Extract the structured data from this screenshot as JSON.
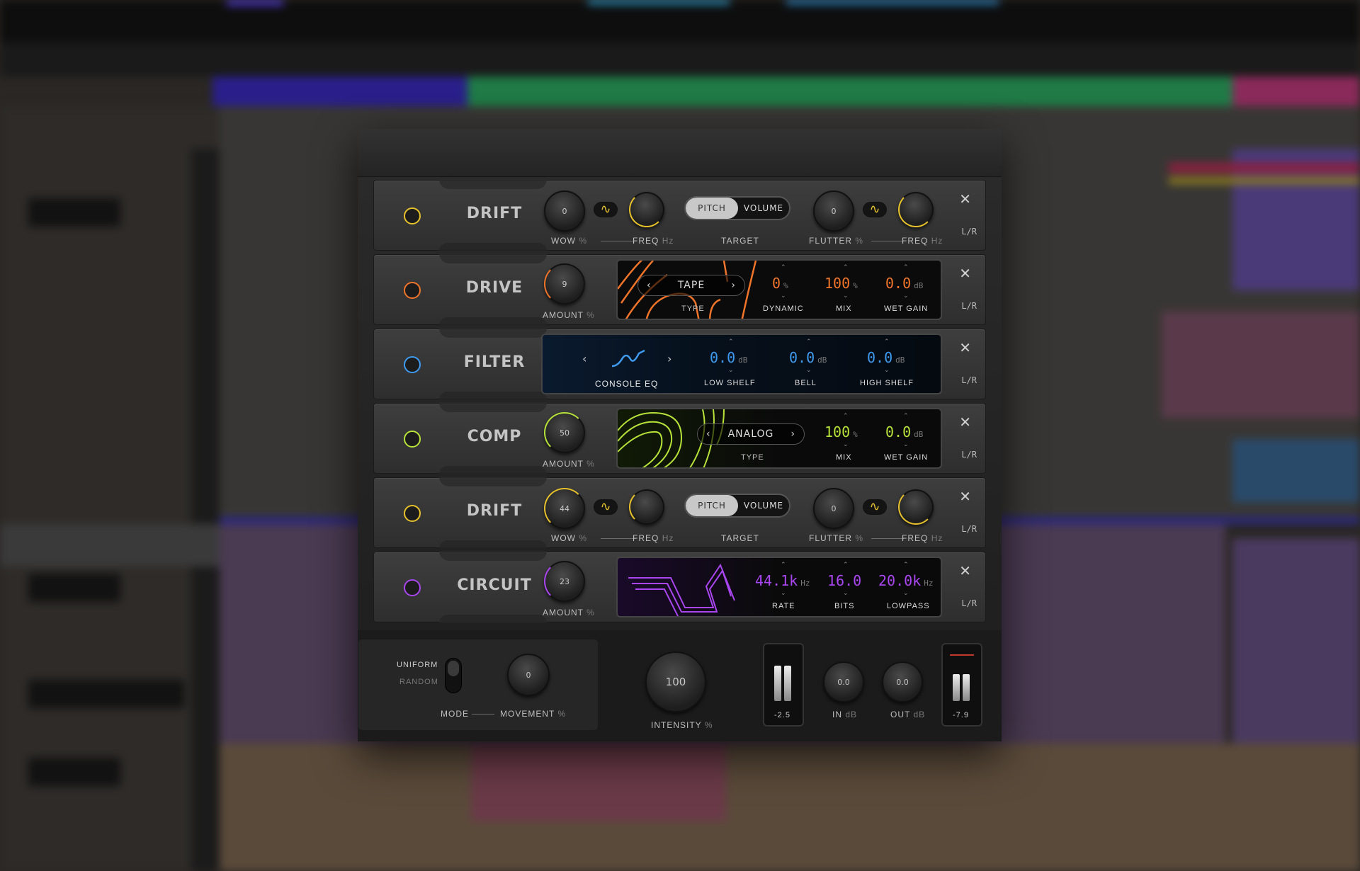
{
  "colors": {
    "drift": "#e6c12c",
    "drive": "#f0742a",
    "filter": "#3f9bf0",
    "comp": "#b7e23a",
    "circuit": "#a946f0",
    "segment_active": "#c8c8c8"
  },
  "modules": [
    {
      "name": "DRIFT",
      "close": "✕",
      "channel": "L/R",
      "wow_value": "0",
      "wow_label": "WOW",
      "wow_unit": "%",
      "freq1_label": "FREQ",
      "freq1_unit": "Hz",
      "target_options": [
        "PITCH",
        "VOLUME"
      ],
      "target_selected": "PITCH",
      "target_label": "TARGET",
      "flutter_value": "0",
      "flutter_label": "FLUTTER",
      "flutter_unit": "%",
      "freq2_label": "FREQ",
      "freq2_unit": "Hz",
      "wave_icon": "sine-wave-icon"
    },
    {
      "name": "DRIVE",
      "close": "✕",
      "channel": "L/R",
      "amount_value": "9",
      "amount_label": "AMOUNT",
      "amount_unit": "%",
      "type_value": "TAPE",
      "type_label": "TYPE",
      "dynamic_value": "0",
      "dynamic_unit": "%",
      "dynamic_label": "DYNAMIC",
      "mix_value": "100",
      "mix_unit": "%",
      "mix_label": "MIX",
      "wetgain_value": "0.0",
      "wetgain_unit": "dB",
      "wetgain_label": "WET GAIN"
    },
    {
      "name": "FILTER",
      "close": "✕",
      "channel": "L/R",
      "type_value": "CONSOLE EQ",
      "low_value": "0.0",
      "low_unit": "dB",
      "low_label": "LOW SHELF",
      "bell_value": "0.0",
      "bell_unit": "dB",
      "bell_label": "BELL",
      "high_value": "0.0",
      "high_unit": "dB",
      "high_label": "HIGH SHELF"
    },
    {
      "name": "COMP",
      "close": "✕",
      "channel": "L/R",
      "amount_value": "50",
      "amount_label": "AMOUNT",
      "amount_unit": "%",
      "type_value": "ANALOG",
      "type_label": "TYPE",
      "mix_value": "100",
      "mix_unit": "%",
      "mix_label": "MIX",
      "wetgain_value": "0.0",
      "wetgain_unit": "dB",
      "wetgain_label": "WET GAIN"
    },
    {
      "name": "DRIFT",
      "close": "✕",
      "channel": "L/R",
      "wow_value": "44",
      "wow_label": "WOW",
      "wow_unit": "%",
      "freq1_label": "FREQ",
      "freq1_unit": "Hz",
      "target_options": [
        "PITCH",
        "VOLUME"
      ],
      "target_selected": "PITCH",
      "target_label": "TARGET",
      "flutter_value": "0",
      "flutter_label": "FLUTTER",
      "flutter_unit": "%",
      "freq2_label": "FREQ",
      "freq2_unit": "Hz",
      "wave_icon": "sine-wave-icon"
    },
    {
      "name": "CIRCUIT",
      "close": "✕",
      "channel": "L/R",
      "amount_value": "23",
      "amount_label": "AMOUNT",
      "amount_unit": "%",
      "rate_value": "44.1k",
      "rate_unit": "Hz",
      "rate_label": "RATE",
      "bits_value": "16.0",
      "bits_label": "BITS",
      "lowpass_value": "20.0k",
      "lowpass_unit": "Hz",
      "lowpass_label": "LOWPASS"
    }
  ],
  "footer": {
    "mode_options": [
      "UNIFORM",
      "RANDOM"
    ],
    "mode_selected": "UNIFORM",
    "mode_label": "MODE",
    "movement_value": "0",
    "movement_label": "MOVEMENT",
    "movement_unit": "%",
    "intensity_value": "100",
    "intensity_label": "INTENSITY",
    "intensity_unit": "%",
    "in_meter_value": "-2.5",
    "in_value": "0.0",
    "in_label": "IN",
    "in_unit": "dB",
    "out_value": "0.0",
    "out_label": "OUT",
    "out_unit": "dB",
    "out_meter_value": "-7.9"
  }
}
